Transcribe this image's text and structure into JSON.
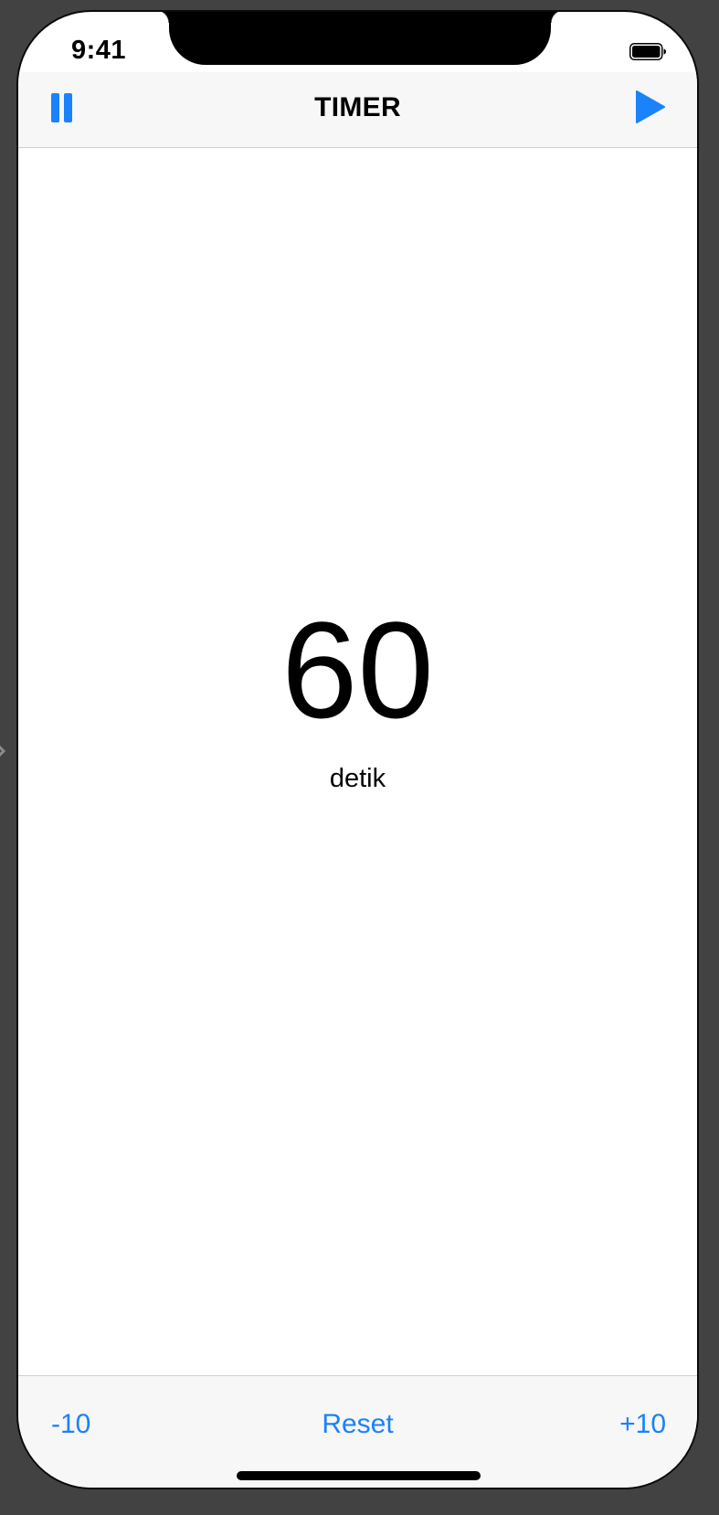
{
  "status_bar": {
    "time": "9:41",
    "battery_icon": "battery-full-icon"
  },
  "nav": {
    "title": "TIMER",
    "left_icon": "pause-icon",
    "right_icon": "play-icon"
  },
  "timer": {
    "value": "60",
    "unit": "detik"
  },
  "toolbar": {
    "minus_label": "-10",
    "reset_label": "Reset",
    "plus_label": "+10"
  },
  "colors": {
    "accent": "#1a82fb",
    "bar_background": "#f7f7f7",
    "canvas_background": "#424242"
  }
}
